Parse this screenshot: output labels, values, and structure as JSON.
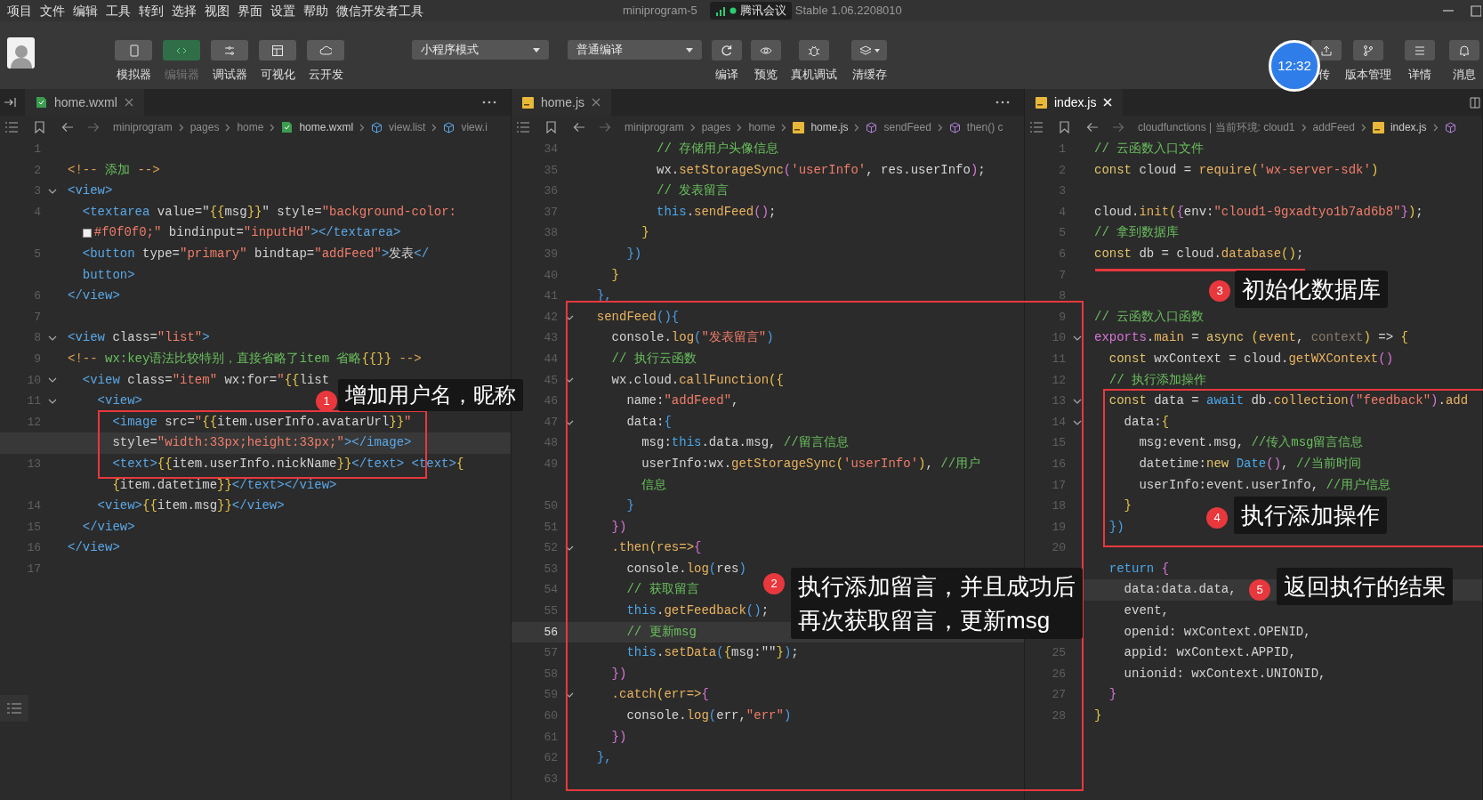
{
  "menu": [
    "项目",
    "文件",
    "编辑",
    "工具",
    "转到",
    "选择",
    "视图",
    "界面",
    "设置",
    "帮助",
    "微信开发者工具"
  ],
  "window": {
    "title_left": "miniprogram-5",
    "meeting": "腾讯会议",
    "title_right": "Stable 1.06.2208010"
  },
  "toolbar": {
    "view_buttons": [
      {
        "label": "模拟器",
        "selected": false
      },
      {
        "label": "编辑器",
        "selected": true
      },
      {
        "label": "调试器",
        "selected": false
      },
      {
        "label": "可视化",
        "selected": false
      },
      {
        "label": "云开发",
        "selected": false
      }
    ],
    "mode_select": "小程序模式",
    "compile_select": "普通编译",
    "actions": [
      {
        "label": "编译"
      },
      {
        "label": "预览"
      },
      {
        "label": "真机调试"
      },
      {
        "label": "清缓存"
      }
    ],
    "right_actions": [
      {
        "label": "传"
      },
      {
        "label": "版本管理"
      },
      {
        "label": "详情"
      },
      {
        "label": "消息"
      }
    ],
    "clock": "12:32"
  },
  "panes": [
    {
      "tab": {
        "label": "home.wxml",
        "kind": "wxml",
        "selected": false
      },
      "breadcrumb": [
        {
          "label": "miniprogram",
          "kind": "text"
        },
        {
          "label": "pages",
          "kind": "text"
        },
        {
          "label": "home",
          "kind": "text"
        },
        {
          "label": "home.wxml",
          "kind": "wxml"
        },
        {
          "label": "view.list",
          "kind": "element"
        },
        {
          "label": "view.i",
          "kind": "element"
        }
      ],
      "lines": [
        {
          "num": "1",
          "current": false
        },
        {
          "num": "2",
          "current": false,
          "tokens": [
            {
              "kind": "o",
              "text": "<!-- "
            },
            {
              "kind": "cm",
              "text": "添加"
            },
            {
              "kind": "o",
              "text": " -->"
            }
          ]
        },
        {
          "num": "3",
          "current": false,
          "expanded": true,
          "tokens": [
            {
              "kind": "tag",
              "text": "<view>"
            }
          ]
        },
        {
          "num": "4",
          "current": false,
          "tokens": [
            {
              "kind": "tag",
              "text": "  <textarea "
            },
            {
              "kind": "p",
              "text": "value=\""
            },
            {
              "kind": "y",
              "text": "{{"
            },
            {
              "kind": "p",
              "text": "msg"
            },
            {
              "kind": "y",
              "text": "}}"
            },
            {
              "kind": "p",
              "text": "\" style="
            },
            {
              "kind": "str",
              "text": "\"background-color:"
            }
          ]
        },
        {
          "current": false,
          "tokens": [
            {
              "kind": "hex",
              "text": "  #f0f0f0;\""
            },
            {
              "kind": "p",
              "text": " bindinput="
            },
            {
              "kind": "str",
              "text": "\"inputHd\""
            },
            {
              "kind": "tag",
              "text": "></textarea>"
            }
          ]
        },
        {
          "num": "5",
          "current": false,
          "tokens": [
            {
              "kind": "tag",
              "text": "  <button "
            },
            {
              "kind": "p",
              "text": "type="
            },
            {
              "kind": "str",
              "text": "\"primary\""
            },
            {
              "kind": "p",
              "text": " bindtap="
            },
            {
              "kind": "str",
              "text": "\"addFeed\""
            },
            {
              "kind": "tag",
              "text": ">"
            },
            {
              "kind": "p",
              "text": "发表"
            },
            {
              "kind": "tag",
              "text": "</"
            }
          ]
        },
        {
          "current": false,
          "tokens": [
            {
              "kind": "tag",
              "text": "  button>"
            }
          ]
        },
        {
          "num": "6",
          "current": false,
          "tokens": [
            {
              "kind": "tag",
              "text": "</view>"
            }
          ]
        },
        {
          "num": "7",
          "current": false
        },
        {
          "num": "8",
          "current": false,
          "expanded": true,
          "tokens": [
            {
              "kind": "tag",
              "text": "<view "
            },
            {
              "kind": "p",
              "text": "class="
            },
            {
              "kind": "str",
              "text": "\"list\""
            },
            {
              "kind": "tag",
              "text": ">"
            }
          ]
        },
        {
          "num": "9",
          "current": false,
          "tokens": [
            {
              "kind": "o",
              "text": "<!-- "
            },
            {
              "kind": "cm",
              "text": "wx:key语法比较特别，直接省略了item 省略"
            },
            {
              "kind": "y",
              "text": "{{}}"
            },
            {
              "kind": "o",
              "text": " -->"
            }
          ]
        },
        {
          "num": "10",
          "current": false,
          "expanded": true,
          "tokens": [
            {
              "kind": "tag",
              "text": "  <view "
            },
            {
              "kind": "p",
              "text": "class="
            },
            {
              "kind": "str",
              "text": "\"item\""
            },
            {
              "kind": "p",
              "text": " wx:for="
            },
            {
              "kind": "str",
              "text": "\""
            },
            {
              "kind": "y",
              "text": "{{"
            },
            {
              "kind": "p",
              "text": "list"
            }
          ]
        },
        {
          "num": "11",
          "current": false,
          "expanded": true,
          "tokens": [
            {
              "kind": "tag",
              "text": "    <view>"
            }
          ]
        },
        {
          "num": "12",
          "current": false,
          "tokens": [
            {
              "kind": "tag",
              "text": "      <image "
            },
            {
              "kind": "p",
              "text": "src="
            },
            {
              "kind": "str",
              "text": "\""
            },
            {
              "kind": "y",
              "text": "{{"
            },
            {
              "kind": "p",
              "text": "item.userInfo.avatarUrl"
            },
            {
              "kind": "y",
              "text": "}}"
            },
            {
              "kind": "str",
              "text": "\""
            }
          ]
        },
        {
          "current": true,
          "tokens": [
            {
              "kind": "p",
              "text": "      style="
            },
            {
              "kind": "str",
              "text": "\"width:33px;height:33px;\""
            },
            {
              "kind": "tag",
              "text": "></image>"
            }
          ]
        },
        {
          "num": "13",
          "current": false,
          "tokens": [
            {
              "kind": "tag",
              "text": "      <text>"
            },
            {
              "kind": "y",
              "text": "{{"
            },
            {
              "kind": "p",
              "text": "item.userInfo.nickName"
            },
            {
              "kind": "y",
              "text": "}}"
            },
            {
              "kind": "tag",
              "text": "</text> <text>"
            },
            {
              "kind": "y",
              "text": "{"
            }
          ]
        },
        {
          "current": false,
          "tokens": [
            {
              "kind": "y",
              "text": "      {"
            },
            {
              "kind": "p",
              "text": "item.datetime"
            },
            {
              "kind": "y",
              "text": "}}"
            },
            {
              "kind": "tag",
              "text": "</text></view>"
            }
          ]
        },
        {
          "num": "14",
          "current": false,
          "tokens": [
            {
              "kind": "tag",
              "text": "    <view>"
            },
            {
              "kind": "y",
              "text": "{{"
            },
            {
              "kind": "p",
              "text": "item.msg"
            },
            {
              "kind": "y",
              "text": "}}"
            },
            {
              "kind": "tag",
              "text": "</view>"
            }
          ]
        },
        {
          "num": "15",
          "current": false,
          "tokens": [
            {
              "kind": "tag",
              "text": "  </view>"
            }
          ]
        },
        {
          "num": "16",
          "current": false,
          "tokens": [
            {
              "kind": "tag",
              "text": "</view>"
            }
          ]
        },
        {
          "num": "17",
          "current": false
        }
      ]
    },
    {
      "tab": {
        "label": "home.js",
        "kind": "js",
        "selected": false
      },
      "breadcrumb": [
        {
          "label": "miniprogram",
          "kind": "text"
        },
        {
          "label": "pages",
          "kind": "text"
        },
        {
          "label": "home",
          "kind": "text"
        },
        {
          "label": "home.js",
          "kind": "js"
        },
        {
          "label": "sendFeed",
          "kind": "method"
        },
        {
          "label": "then() c",
          "kind": "method"
        }
      ],
      "lines": [
        {
          "num": "34",
          "current": false,
          "tokens": [
            {
              "kind": "cm",
              "text": "          // 存储用户头像信息"
            }
          ]
        },
        {
          "num": "35",
          "current": false,
          "tokens": [
            {
              "kind": "p",
              "text": "          wx."
            },
            {
              "kind": "fn",
              "text": "setStorageSync"
            },
            {
              "kind": "m",
              "text": "("
            },
            {
              "kind": "str",
              "text": "'userInfo'"
            },
            {
              "kind": "p",
              "text": ", res.userInfo"
            },
            {
              "kind": "m",
              "text": ")"
            },
            {
              "kind": "p",
              "text": ";"
            }
          ]
        },
        {
          "num": "36",
          "current": false,
          "tokens": [
            {
              "kind": "cm",
              "text": "          // 发表留言"
            }
          ]
        },
        {
          "num": "37",
          "current": false,
          "tokens": [
            {
              "kind": "th",
              "text": "          this"
            },
            {
              "kind": "p",
              "text": "."
            },
            {
              "kind": "fn",
              "text": "sendFeed"
            },
            {
              "kind": "m",
              "text": "()"
            },
            {
              "kind": "p",
              "text": ";"
            }
          ]
        },
        {
          "num": "38",
          "current": false,
          "tokens": [
            {
              "kind": "y",
              "text": "        }"
            }
          ]
        },
        {
          "num": "39",
          "current": false,
          "tokens": [
            {
              "kind": "b",
              "text": "      })"
            }
          ]
        },
        {
          "num": "40",
          "current": false,
          "tokens": [
            {
              "kind": "y",
              "text": "    }"
            }
          ]
        },
        {
          "num": "41",
          "current": false,
          "tokens": [
            {
              "kind": "b",
              "text": "  },"
            }
          ]
        },
        {
          "num": "42",
          "current": false,
          "expanded": true,
          "tokens": [
            {
              "kind": "fn",
              "text": "  sendFeed"
            },
            {
              "kind": "b",
              "text": "(){"
            }
          ]
        },
        {
          "num": "43",
          "current": false,
          "tokens": [
            {
              "kind": "p",
              "text": "    console."
            },
            {
              "kind": "fn",
              "text": "log"
            },
            {
              "kind": "b",
              "text": "("
            },
            {
              "kind": "str",
              "text": "\"发表留言\""
            },
            {
              "kind": "b",
              "text": ")"
            }
          ]
        },
        {
          "num": "44",
          "current": false,
          "tokens": [
            {
              "kind": "cm",
              "text": "    // 执行云函数"
            }
          ]
        },
        {
          "num": "45",
          "current": false,
          "expanded": true,
          "tokens": [
            {
              "kind": "p",
              "text": "    wx.cloud."
            },
            {
              "kind": "fn",
              "text": "callFunction"
            },
            {
              "kind": "y",
              "text": "({"
            }
          ]
        },
        {
          "num": "46",
          "current": false,
          "tokens": [
            {
              "kind": "p",
              "text": "      name:"
            },
            {
              "kind": "str",
              "text": "\"addFeed\""
            },
            {
              "kind": "p",
              "text": ","
            }
          ]
        },
        {
          "num": "47",
          "current": false,
          "expanded": true,
          "tokens": [
            {
              "kind": "p",
              "text": "      data:"
            },
            {
              "kind": "b",
              "text": "{"
            }
          ]
        },
        {
          "num": "48",
          "current": false,
          "tokens": [
            {
              "kind": "p",
              "text": "        msg:"
            },
            {
              "kind": "th",
              "text": "this"
            },
            {
              "kind": "p",
              "text": ".data.msg, "
            },
            {
              "kind": "cm",
              "text": "//留言信息"
            }
          ]
        },
        {
          "num": "49",
          "current": false,
          "tokens": [
            {
              "kind": "p",
              "text": "        userInfo:wx."
            },
            {
              "kind": "fn",
              "text": "getStorageSync"
            },
            {
              "kind": "y",
              "text": "("
            },
            {
              "kind": "str",
              "text": "'userInfo'"
            },
            {
              "kind": "y",
              "text": ")"
            },
            {
              "kind": "p",
              "text": ", "
            },
            {
              "kind": "cm",
              "text": "//用户"
            }
          ]
        },
        {
          "current": false,
          "tokens": [
            {
              "kind": "cm",
              "text": "        信息"
            }
          ]
        },
        {
          "num": "50",
          "current": false,
          "tokens": [
            {
              "kind": "b",
              "text": "      }"
            }
          ]
        },
        {
          "num": "51",
          "current": false,
          "tokens": [
            {
              "kind": "m",
              "text": "    })"
            }
          ]
        },
        {
          "num": "52",
          "current": false,
          "expanded": true,
          "tokens": [
            {
              "kind": "fn",
              "text": "    .then"
            },
            {
              "kind": "y",
              "text": "("
            },
            {
              "kind": "fn",
              "text": "res=>"
            },
            {
              "kind": "m",
              "text": "{"
            }
          ]
        },
        {
          "num": "53",
          "current": false,
          "tokens": [
            {
              "kind": "p",
              "text": "      console."
            },
            {
              "kind": "fn",
              "text": "log"
            },
            {
              "kind": "b",
              "text": "("
            },
            {
              "kind": "p",
              "text": "res"
            },
            {
              "kind": "b",
              "text": ")"
            }
          ]
        },
        {
          "num": "54",
          "current": false,
          "tokens": [
            {
              "kind": "cm",
              "text": "      // 获取留言"
            }
          ]
        },
        {
          "num": "55",
          "current": false,
          "tokens": [
            {
              "kind": "th",
              "text": "      this"
            },
            {
              "kind": "p",
              "text": "."
            },
            {
              "kind": "fn",
              "text": "getFeedback"
            },
            {
              "kind": "b",
              "text": "()"
            },
            {
              "kind": "p",
              "text": ";"
            }
          ]
        },
        {
          "num": "56",
          "current": true,
          "tokens": [
            {
              "kind": "cm",
              "text": "      // 更新msg"
            }
          ]
        },
        {
          "num": "57",
          "current": false,
          "tokens": [
            {
              "kind": "th",
              "text": "      this"
            },
            {
              "kind": "p",
              "text": "."
            },
            {
              "kind": "fn",
              "text": "setData"
            },
            {
              "kind": "b",
              "text": "("
            },
            {
              "kind": "y",
              "text": "{"
            },
            {
              "kind": "p",
              "text": "msg:\"\""
            },
            {
              "kind": "y",
              "text": "}"
            },
            {
              "kind": "b",
              "text": ")"
            },
            {
              "kind": "p",
              "text": ";"
            }
          ]
        },
        {
          "num": "58",
          "current": false,
          "tokens": [
            {
              "kind": "m",
              "text": "    })"
            }
          ]
        },
        {
          "num": "59",
          "current": false,
          "expanded": true,
          "tokens": [
            {
              "kind": "fn",
              "text": "    .catch"
            },
            {
              "kind": "y",
              "text": "("
            },
            {
              "kind": "fn",
              "text": "err=>"
            },
            {
              "kind": "m",
              "text": "{"
            }
          ]
        },
        {
          "num": "60",
          "current": false,
          "tokens": [
            {
              "kind": "p",
              "text": "      console."
            },
            {
              "kind": "fn",
              "text": "log"
            },
            {
              "kind": "b",
              "text": "("
            },
            {
              "kind": "p",
              "text": "err,"
            },
            {
              "kind": "str",
              "text": "\"err\""
            },
            {
              "kind": "b",
              "text": ")"
            }
          ]
        },
        {
          "num": "61",
          "current": false,
          "tokens": [
            {
              "kind": "m",
              "text": "    })"
            }
          ]
        },
        {
          "num": "62",
          "current": false,
          "tokens": [
            {
              "kind": "b",
              "text": "  },"
            }
          ]
        },
        {
          "num": "63",
          "current": false
        }
      ]
    },
    {
      "tab": {
        "label": "index.js",
        "kind": "js",
        "selected": true
      },
      "breadcrumb": [
        {
          "label": "cloudfunctions | 当前环境: cloud1",
          "kind": "text"
        },
        {
          "label": "addFeed",
          "kind": "text"
        },
        {
          "label": "index.js",
          "kind": "js"
        }
      ],
      "lines": [
        {
          "num": "1",
          "current": false,
          "tokens": [
            {
              "kind": "cm",
              "text": "// 云函数入口文件"
            }
          ]
        },
        {
          "num": "2",
          "current": false,
          "tokens": [
            {
              "kind": "kw",
              "text": "const"
            },
            {
              "kind": "p",
              "text": " cloud = "
            },
            {
              "kind": "fn",
              "text": "require"
            },
            {
              "kind": "y",
              "text": "("
            },
            {
              "kind": "str",
              "text": "'wx-server-sdk'"
            },
            {
              "kind": "y",
              "text": ")"
            }
          ]
        },
        {
          "num": "3",
          "current": false
        },
        {
          "num": "4",
          "current": false,
          "tokens": [
            {
              "kind": "p",
              "text": "cloud."
            },
            {
              "kind": "fn",
              "text": "init"
            },
            {
              "kind": "y",
              "text": "("
            },
            {
              "kind": "m",
              "text": "{"
            },
            {
              "kind": "p",
              "text": "env:"
            },
            {
              "kind": "str",
              "text": "\"cloud1-9gxadtyo1b7ad6b8\""
            },
            {
              "kind": "m",
              "text": "}"
            },
            {
              "kind": "y",
              "text": ")"
            },
            {
              "kind": "p",
              "text": ";"
            }
          ]
        },
        {
          "num": "5",
          "current": false,
          "tokens": [
            {
              "kind": "cm",
              "text": "// 拿到数据库"
            }
          ]
        },
        {
          "num": "6",
          "current": false,
          "tokens": [
            {
              "kind": "kw",
              "text": "const"
            },
            {
              "kind": "p",
              "text": " db = cloud."
            },
            {
              "kind": "fn",
              "text": "database"
            },
            {
              "kind": "y",
              "text": "()"
            },
            {
              "kind": "p",
              "text": ";"
            }
          ]
        },
        {
          "num": "7",
          "current": false
        },
        {
          "num": "8",
          "current": false
        },
        {
          "num": "9",
          "current": false,
          "tokens": [
            {
              "kind": "cm",
              "text": "// 云函数入口函数"
            }
          ]
        },
        {
          "num": "10",
          "current": false,
          "expanded": true,
          "tokens": [
            {
              "kind": "m",
              "text": "exports"
            },
            {
              "kind": "p",
              "text": "."
            },
            {
              "kind": "fn",
              "text": "main"
            },
            {
              "kind": "p",
              "text": " = "
            },
            {
              "kind": "kw",
              "text": "async "
            },
            {
              "kind": "y",
              "text": "("
            },
            {
              "kind": "fn",
              "text": "event"
            },
            {
              "kind": "p",
              "text": ", "
            },
            {
              "kind": "dim",
              "text": "context"
            },
            {
              "kind": "y",
              "text": ")"
            },
            {
              "kind": "p",
              "text": " => "
            },
            {
              "kind": "y",
              "text": "{"
            }
          ]
        },
        {
          "num": "11",
          "current": false,
          "tokens": [
            {
              "kind": "kw",
              "text": "  const"
            },
            {
              "kind": "p",
              "text": " wxContext = cloud."
            },
            {
              "kind": "fn",
              "text": "getWXContext"
            },
            {
              "kind": "m",
              "text": "()"
            }
          ]
        },
        {
          "num": "12",
          "current": false,
          "tokens": [
            {
              "kind": "cm",
              "text": "  // 执行添加操作"
            }
          ]
        },
        {
          "num": "13",
          "current": false,
          "expanded": true,
          "tokens": [
            {
              "kind": "kw",
              "text": "  const"
            },
            {
              "kind": "p",
              "text": " data = "
            },
            {
              "kind": "th",
              "text": "await"
            },
            {
              "kind": "p",
              "text": " db."
            },
            {
              "kind": "fn",
              "text": "collection"
            },
            {
              "kind": "m",
              "text": "("
            },
            {
              "kind": "str",
              "text": "\"feedback\""
            },
            {
              "kind": "m",
              "text": ")"
            },
            {
              "kind": "p",
              "text": "."
            },
            {
              "kind": "fn",
              "text": "add"
            }
          ]
        },
        {
          "num": "14",
          "current": false,
          "expanded": true,
          "tokens": [
            {
              "kind": "p",
              "text": "    data:"
            },
            {
              "kind": "y",
              "text": "{"
            }
          ]
        },
        {
          "num": "15",
          "current": false,
          "tokens": [
            {
              "kind": "p",
              "text": "      msg:event.msg, "
            },
            {
              "kind": "cm",
              "text": "//传入msg留言信息"
            }
          ]
        },
        {
          "num": "16",
          "current": false,
          "tokens": [
            {
              "kind": "p",
              "text": "      datetime:"
            },
            {
              "kind": "kw",
              "text": "new "
            },
            {
              "kind": "th",
              "text": "Date"
            },
            {
              "kind": "m",
              "text": "()"
            },
            {
              "kind": "p",
              "text": ", "
            },
            {
              "kind": "cm",
              "text": "//当前时间"
            }
          ]
        },
        {
          "num": "17",
          "current": false,
          "tokens": [
            {
              "kind": "p",
              "text": "      userInfo:event.userInfo, "
            },
            {
              "kind": "cm",
              "text": "//用户信息"
            }
          ]
        },
        {
          "num": "18",
          "current": false,
          "tokens": [
            {
              "kind": "y",
              "text": "    }"
            }
          ]
        },
        {
          "num": "19",
          "current": false,
          "tokens": [
            {
              "kind": "b",
              "text": "  })"
            }
          ]
        },
        {
          "num": "20",
          "current": false
        },
        {
          "current": false,
          "tokens": [
            {
              "kind": "th",
              "text": "  return "
            },
            {
              "kind": "m",
              "text": "{"
            }
          ]
        },
        {
          "current": true,
          "tokens": [
            {
              "kind": "p",
              "text": "    data:data.data,"
            }
          ]
        },
        {
          "current": false,
          "tokens": [
            {
              "kind": "p",
              "text": "    event,"
            }
          ]
        },
        {
          "current": false,
          "tokens": [
            {
              "kind": "p",
              "text": "    openid: wxContext.OPENID,"
            }
          ]
        },
        {
          "num": "25",
          "current": false,
          "tokens": [
            {
              "kind": "p",
              "text": "    appid: wxContext.APPID,"
            }
          ]
        },
        {
          "num": "26",
          "current": false,
          "tokens": [
            {
              "kind": "p",
              "text": "    unionid: wxContext.UNIONID,"
            }
          ]
        },
        {
          "num": "27",
          "current": false,
          "tokens": [
            {
              "kind": "m",
              "text": "  }"
            }
          ]
        },
        {
          "num": "28",
          "current": false,
          "tokens": [
            {
              "kind": "y",
              "text": "}"
            }
          ]
        }
      ]
    }
  ],
  "annotations": [
    {
      "number": "1",
      "lines": [
        "增加用户名，昵称"
      ]
    },
    {
      "number": "2",
      "lines": [
        "执行添加留言，并且成功后",
        "再次获取留言，更新msg"
      ]
    },
    {
      "number": "3",
      "lines": [
        "初始化数据库"
      ]
    },
    {
      "number": "4",
      "lines": [
        "执行添加操作"
      ]
    },
    {
      "number": "5",
      "lines": [
        "返回执行的结果"
      ]
    }
  ]
}
